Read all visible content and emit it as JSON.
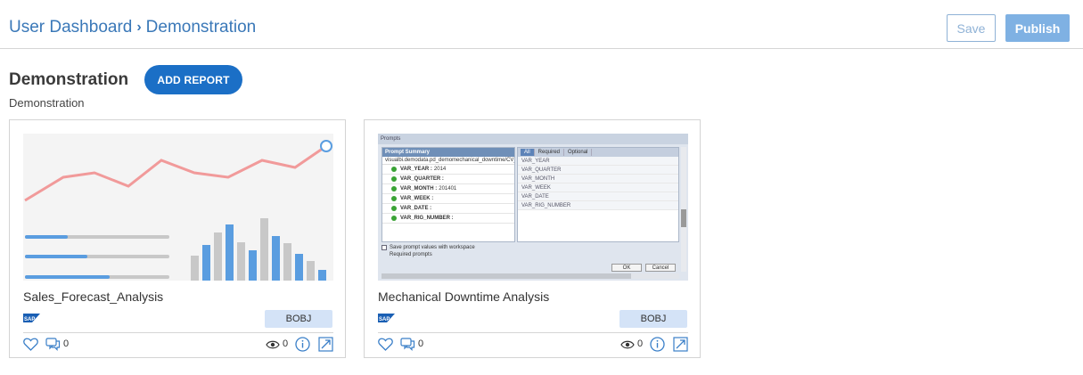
{
  "header": {
    "breadcrumb_root": "User Dashboard",
    "breadcrumb_sep": "›",
    "breadcrumb_current": "Demonstration",
    "save_label": "Save",
    "publish_label": "Publish"
  },
  "page": {
    "title": "Demonstration",
    "add_report_label": "ADD REPORT",
    "subtitle": "Demonstration"
  },
  "colors": {
    "accent": "#1b6fc6",
    "link": "#3a78b8",
    "publish": "#7fb1e3",
    "badge_bg": "#d4e3f7",
    "chart_line": "#f19a9a",
    "chart_bar_blue": "#5a9de0",
    "chart_bar_gray": "#c8c8c8"
  },
  "cards": [
    {
      "title": "Sales_Forecast_Analysis",
      "vendor_icon": "sap-logo",
      "badge": "BOBJ",
      "comment_count": "0",
      "view_count": "0"
    },
    {
      "title": "Mechanical Downtime Analysis",
      "vendor_icon": "sap-logo",
      "badge": "BOBJ",
      "comment_count": "0",
      "view_count": "0",
      "preview": {
        "window_title": "Prompts",
        "left_header": "Prompt Summary",
        "path": "visualbi.demodata.pd_demomechanical_downtime/CV_...",
        "prompts": [
          {
            "name": "VAR_YEAR :",
            "value": "2014"
          },
          {
            "name": "VAR_QUARTER :",
            "value": ""
          },
          {
            "name": "VAR_MONTH :",
            "value": "201401"
          },
          {
            "name": "VAR_WEEK :",
            "value": ""
          },
          {
            "name": "VAR_DATE :",
            "value": ""
          },
          {
            "name": "VAR_RIG_NUMBER :",
            "value": ""
          }
        ],
        "tabs": [
          "All",
          "Required",
          "Optional"
        ],
        "variables": [
          "VAR_YEAR",
          "VAR_QUARTER",
          "VAR_MONTH",
          "VAR_WEEK",
          "VAR_DATE",
          "VAR_RIG_NUMBER"
        ],
        "save_checkbox": "Save prompt values with workspace",
        "required_note": "Required prompts",
        "ok_label": "OK",
        "cancel_label": "Cancel"
      }
    }
  ]
}
